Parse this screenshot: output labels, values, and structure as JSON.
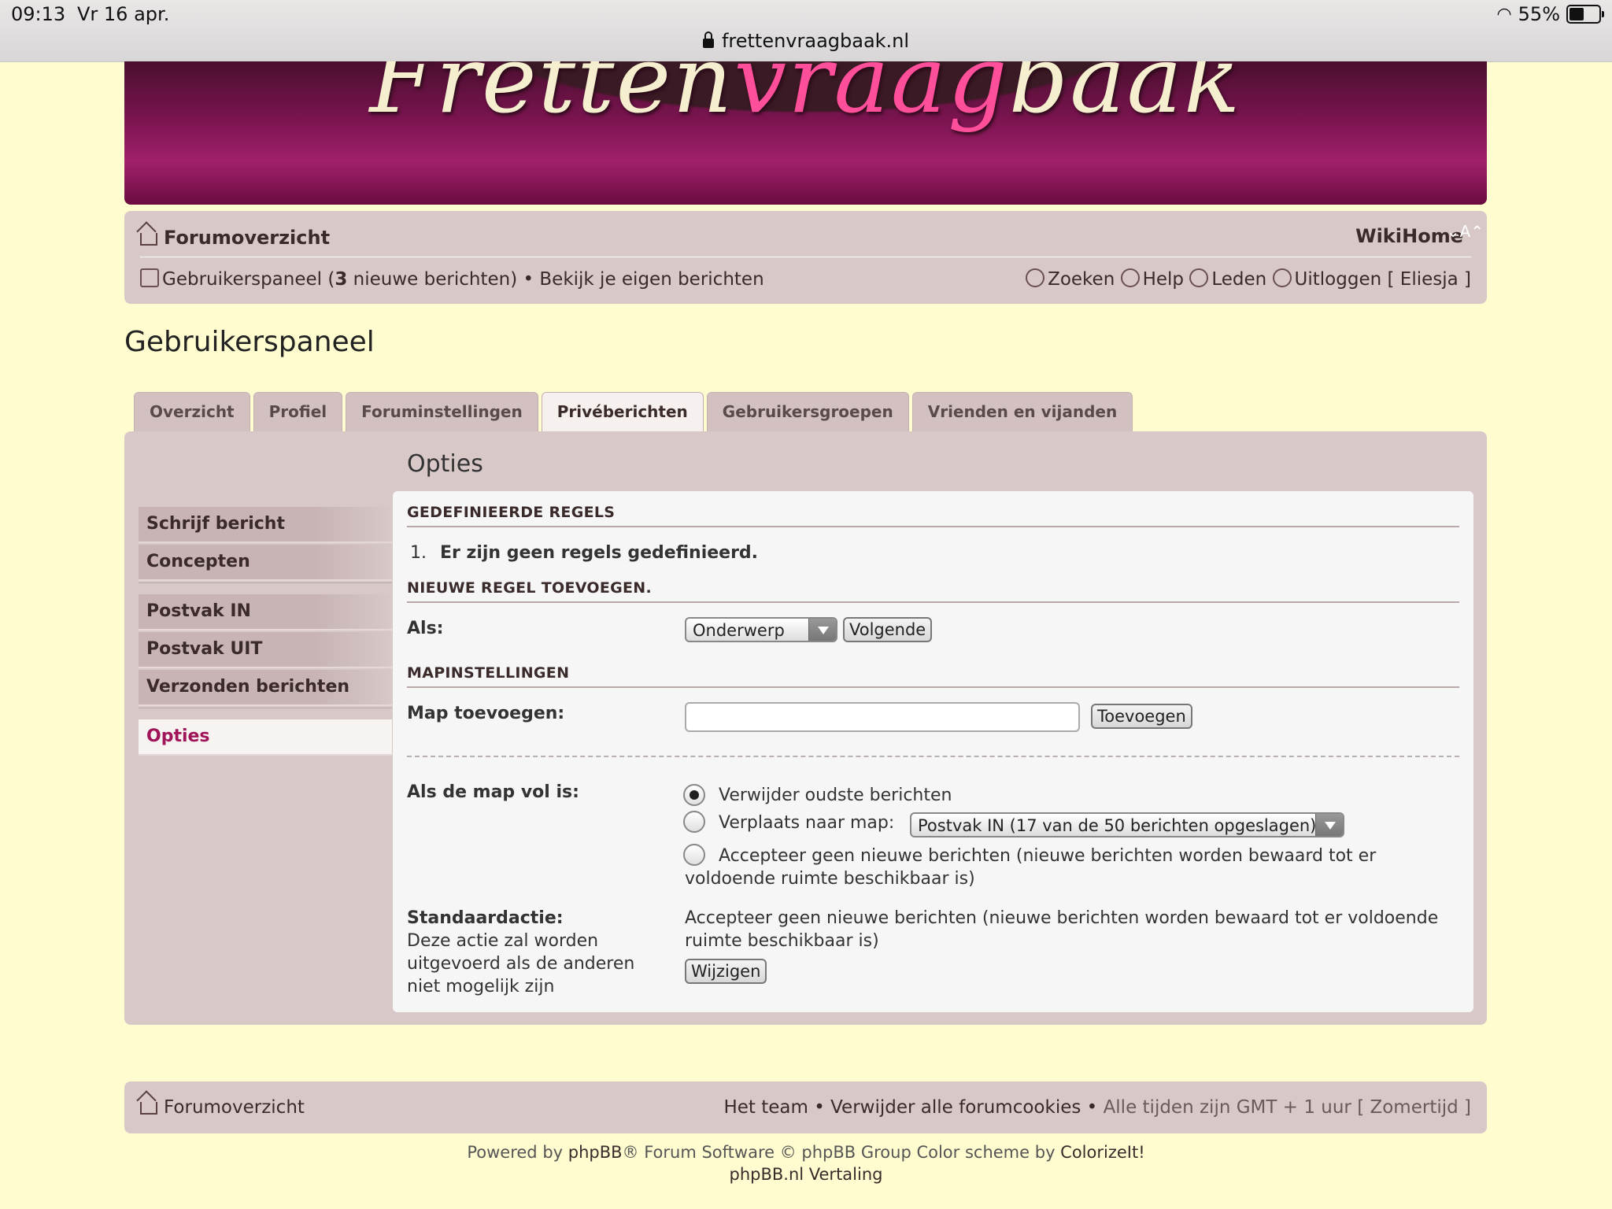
{
  "status_bar": {
    "time": "09:13",
    "date": "Vr 16 apr.",
    "url": "frettenvraagbaak.nl",
    "battery": "55%"
  },
  "banner": {
    "logo_part1": "Fretten",
    "logo_part2": "vraag",
    "logo_part3": "baak"
  },
  "navbar": {
    "forum_overview": "Forumoverzicht",
    "wiki": "Wiki",
    "home": "Home",
    "font_size": "⌄A⌃",
    "user_panel": "Gebruikerspaneel",
    "user_panel_open": " (",
    "new_count": "3",
    "new_messages": " nieuwe berichten)",
    "separator": " • ",
    "own_posts": "Bekijk je eigen berichten",
    "search": "Zoeken",
    "help": "Help",
    "members": "Leden",
    "logout": "Uitloggen",
    "username": "[ Eliesja ]"
  },
  "page_title": "Gebruikerspaneel",
  "tabs": [
    "Overzicht",
    "Profiel",
    "Foruminstellingen",
    "Privéberichten",
    "Gebruikersgroepen",
    "Vrienden en vijanden"
  ],
  "sidebar": {
    "group1": [
      "Schrijf bericht",
      "Concepten"
    ],
    "group2": [
      "Postvak IN",
      "Postvak UIT",
      "Verzonden berichten"
    ],
    "active": "Opties"
  },
  "options": {
    "title": "Opties",
    "section_rules": "GEDEFINIEERDE REGELS",
    "rule_number": "1.",
    "no_rules": "Er zijn geen regels gedefinieerd.",
    "section_new_rule": "NIEUWE REGEL TOEVOEGEN.",
    "if_label": "Als:",
    "if_select": "Onderwerp",
    "next_button": "Volgende",
    "section_folders": "MAPINSTELLINGEN",
    "add_folder_label": "Map toevoegen:",
    "add_folder_value": "",
    "add_button": "Toevoegen",
    "full_label": "Als de map vol is:",
    "radio_delete": "Verwijder oudste berichten",
    "radio_move": "Verplaats naar map:",
    "move_select": "Postvak IN (17 van de 50 berichten opgeslagen)",
    "radio_refuse_line1": "Accepteer geen nieuwe berichten (nieuwe berichten worden bewaard tot er",
    "radio_refuse_line2": "voldoende ruimte beschikbaar is)",
    "default_label": "Standaardactie:",
    "default_desc_1": "Deze actie zal worden",
    "default_desc_2": "uitgevoerd als de anderen",
    "default_desc_3": "niet mogelijk zijn",
    "default_value_1": "Accepteer geen nieuwe berichten (nieuwe berichten worden bewaard tot er voldoende",
    "default_value_2": "ruimte beschikbaar is)",
    "change_button": "Wijzigen"
  },
  "footer": {
    "forum_overview": "Forumoverzicht",
    "team": "Het team",
    "sep": " • ",
    "delete_cookies": "Verwijder alle forumcookies",
    "times": "Alle tijden zijn GMT + 1 uur [ Zomertijd ]"
  },
  "credits": {
    "powered_by": "Powered by ",
    "phpbb": "phpBB",
    "rest": "® Forum Software © phpBB Group Color scheme by ",
    "colorize": "ColorizeIt!",
    "translation": "phpBB.nl Vertaling"
  }
}
